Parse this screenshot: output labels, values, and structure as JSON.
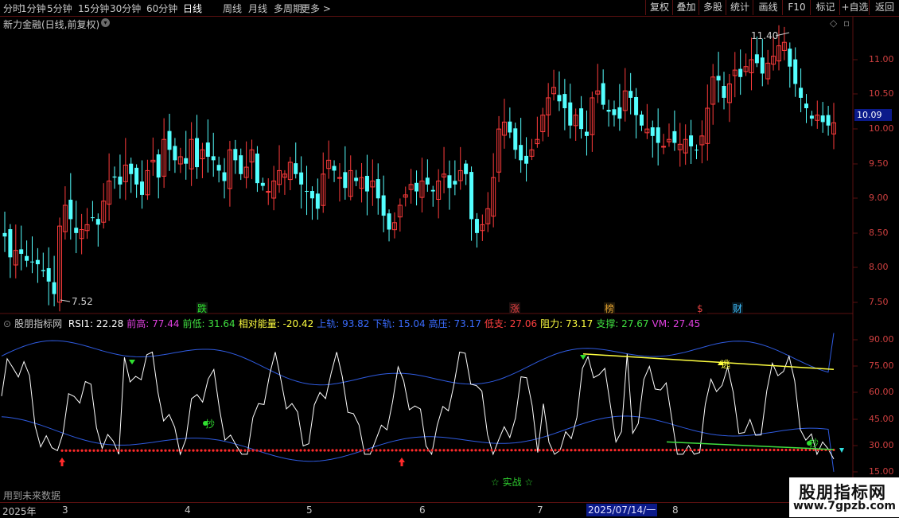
{
  "toolbar": {
    "periods": [
      "分时",
      "1分钟",
      "5分钟",
      "15分钟",
      "30分钟",
      "60分钟",
      "日线",
      "周线",
      "月线",
      "多周期",
      "更多 >"
    ],
    "active_period": "日线",
    "buttons": [
      "复权",
      "叠加",
      "多股",
      "统计",
      "画线",
      "F10",
      "标记",
      "+自选",
      "返回"
    ]
  },
  "stock": {
    "title": "新力金融(日线,前复权)"
  },
  "price_panel": {
    "current_price": "10.09",
    "high_label": "11.40",
    "low_label": "7.52",
    "axis_ticks": [
      "11.00",
      "10.50",
      "10.00",
      "9.50",
      "9.00",
      "8.50",
      "8.00",
      "7.50"
    ],
    "events": [
      {
        "text": "跌",
        "color": "#2ee02e",
        "bg": "#102010"
      },
      {
        "text": "涨",
        "color": "#e04040",
        "bg": "#201010"
      },
      {
        "text": "榜",
        "color": "#e0a030",
        "bg": "#201808"
      },
      {
        "text": "$",
        "color": "#e04040",
        "bg": "#000000"
      },
      {
        "text": "财",
        "color": "#40c0ff",
        "bg": "#081820"
      }
    ]
  },
  "indicator": {
    "name": "股朋指标网",
    "items": [
      {
        "label": "RSI1: 22.28",
        "color": "#ffffff"
      },
      {
        "label": "前高: 77.44",
        "color": "#e040e0"
      },
      {
        "label": "前低: 31.64",
        "color": "#40e040"
      },
      {
        "label": "相对能量: -20.42",
        "color": "#ffff40"
      },
      {
        "label": "上轨: 93.82",
        "color": "#3a6cff"
      },
      {
        "label": "下轨: 15.04",
        "color": "#3a6cff"
      },
      {
        "label": "高压: 73.17",
        "color": "#3a6cff"
      },
      {
        "label": "低支: 27.06",
        "color": "#ff4040"
      },
      {
        "label": "阻力: 73.17",
        "color": "#ffff40"
      },
      {
        "label": "支撑: 27.67",
        "color": "#40e040"
      },
      {
        "label": "VM: 27.45",
        "color": "#e040e0"
      }
    ],
    "axis_ticks": [
      "90.00",
      "75.00",
      "60.00",
      "45.00",
      "30.00",
      "15.00"
    ],
    "signals": {
      "buy": "抄",
      "sell": "逃",
      "buy2": "抄"
    },
    "practice_label": "☆ 实战 ☆",
    "future_note": "用到未来数据"
  },
  "datebar": {
    "year": "2025年",
    "months": [
      "3",
      "4",
      "5",
      "6",
      "7",
      "8"
    ],
    "selected_date": "2025/07/14/一"
  },
  "watermark": {
    "title": "股朋指标网",
    "url": "www.7gpzb.com"
  }
}
